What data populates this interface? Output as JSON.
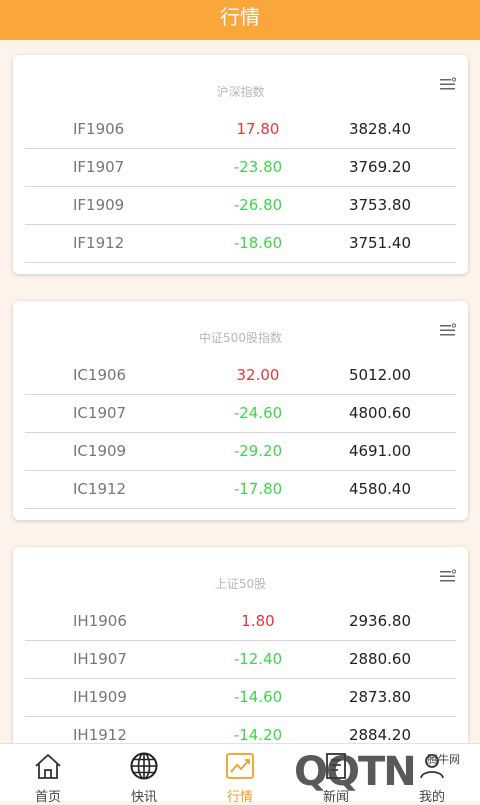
{
  "header": {
    "title": "行情"
  },
  "cards": [
    {
      "title": "沪深指数",
      "rows": [
        {
          "code": "IF1906",
          "change": "17.80",
          "price": "3828.40"
        },
        {
          "code": "IF1907",
          "change": "-23.80",
          "price": "3769.20"
        },
        {
          "code": "IF1909",
          "change": "-26.80",
          "price": "3753.80"
        },
        {
          "code": "IF1912",
          "change": "-18.60",
          "price": "3751.40"
        }
      ]
    },
    {
      "title": "中证500股指数",
      "rows": [
        {
          "code": "IC1906",
          "change": "32.00",
          "price": "5012.00"
        },
        {
          "code": "IC1907",
          "change": "-24.60",
          "price": "4800.60"
        },
        {
          "code": "IC1909",
          "change": "-29.20",
          "price": "4691.00"
        },
        {
          "code": "IC1912",
          "change": "-17.80",
          "price": "4580.40"
        }
      ]
    },
    {
      "title": "上证50股",
      "rows": [
        {
          "code": "IH1906",
          "change": "1.80",
          "price": "2936.80"
        },
        {
          "code": "IH1907",
          "change": "-12.40",
          "price": "2880.60"
        },
        {
          "code": "IH1909",
          "change": "-14.60",
          "price": "2873.80"
        },
        {
          "code": "IH1912",
          "change": "-14.20",
          "price": "2884.20"
        }
      ]
    }
  ],
  "tabs": [
    {
      "label": "首页",
      "icon": "home-icon"
    },
    {
      "label": "快讯",
      "icon": "globe-icon"
    },
    {
      "label": "行情",
      "icon": "chart-icon",
      "active": true
    },
    {
      "label": "新闻",
      "icon": "news-icon"
    },
    {
      "label": "我的",
      "icon": "user-icon"
    }
  ],
  "watermark": {
    "logo": "QQTN",
    "site": "腾牛网"
  },
  "colors": {
    "header": "#f9a63a",
    "up": "#e4393c",
    "down": "#3fd64a",
    "active_tab": "#f39c26"
  }
}
